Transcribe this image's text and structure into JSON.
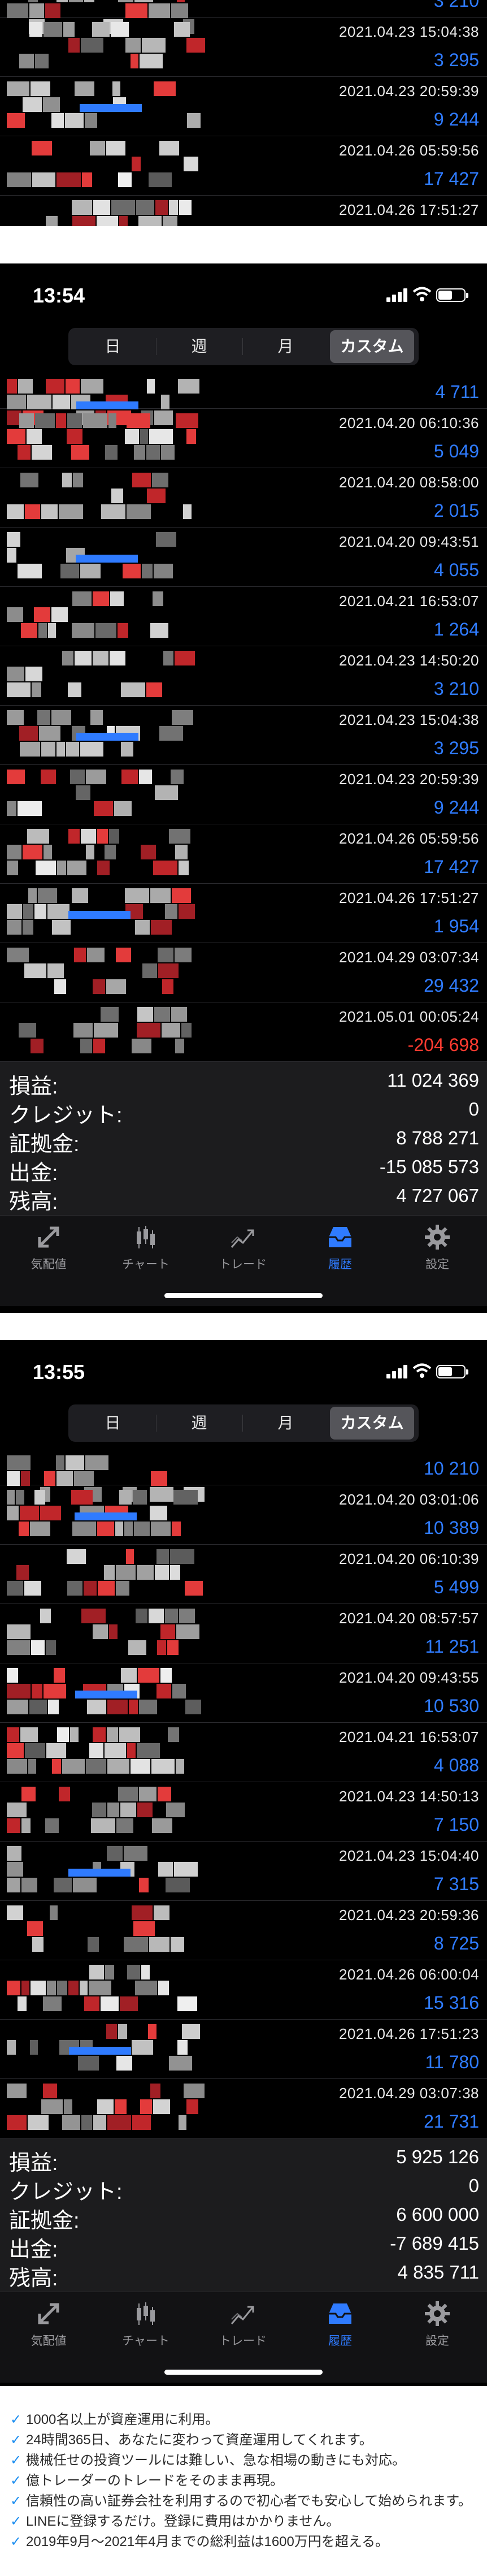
{
  "colors": {
    "positive": "#2f7bff",
    "negative": "#ff3b30",
    "active_tab": "#2f7bff",
    "check": "#1c8ef0"
  },
  "top_fragment": {
    "rows": [
      {
        "date": "",
        "amount": "3 210",
        "sign": "pos"
      },
      {
        "date": "2021.04.23 15:04:38",
        "amount": "3 295",
        "sign": "pos"
      },
      {
        "date": "2021.04.23 20:59:39",
        "amount": "9 244",
        "sign": "pos"
      },
      {
        "date": "2021.04.26 05:59:56",
        "amount": "17 427",
        "sign": "pos"
      },
      {
        "date": "2021.04.26 17:51:27",
        "amount": "",
        "sign": "pos"
      }
    ]
  },
  "screen1": {
    "time": "13:54",
    "battery_level": 0.55,
    "segments": [
      "日",
      "週",
      "月",
      "カスタム"
    ],
    "active_segment": 3,
    "rows": [
      {
        "date": "",
        "amount": "4 711",
        "sign": "pos"
      },
      {
        "date": "2021.04.20 06:10:36",
        "amount": "5 049",
        "sign": "pos"
      },
      {
        "date": "2021.04.20 08:58:00",
        "amount": "2 015",
        "sign": "pos"
      },
      {
        "date": "2021.04.20 09:43:51",
        "amount": "4 055",
        "sign": "pos"
      },
      {
        "date": "2021.04.21 16:53:07",
        "amount": "1 264",
        "sign": "pos"
      },
      {
        "date": "2021.04.23 14:50:20",
        "amount": "3 210",
        "sign": "pos"
      },
      {
        "date": "2021.04.23 15:04:38",
        "amount": "3 295",
        "sign": "pos"
      },
      {
        "date": "2021.04.23 20:59:39",
        "amount": "9 244",
        "sign": "pos"
      },
      {
        "date": "2021.04.26 05:59:56",
        "amount": "17 427",
        "sign": "pos"
      },
      {
        "date": "2021.04.26 17:51:27",
        "amount": "1 954",
        "sign": "pos"
      },
      {
        "date": "2021.04.29 03:07:34",
        "amount": "29 432",
        "sign": "pos"
      },
      {
        "date": "2021.05.01 00:05:24",
        "amount": "-204 698",
        "sign": "neg"
      }
    ],
    "summary": [
      {
        "label": "損益:",
        "value": "11 024 369"
      },
      {
        "label": "クレジット:",
        "value": "0"
      },
      {
        "label": "証拠金:",
        "value": "8 788 271"
      },
      {
        "label": "出金:",
        "value": "-15 085 573"
      },
      {
        "label": "残高:",
        "value": "4 727 067"
      }
    ],
    "tabs": [
      {
        "label": "気配値",
        "icon": "quotes-icon"
      },
      {
        "label": "チャート",
        "icon": "chart-icon"
      },
      {
        "label": "トレード",
        "icon": "trade-icon"
      },
      {
        "label": "履歴",
        "icon": "history-icon"
      },
      {
        "label": "設定",
        "icon": "settings-icon"
      }
    ],
    "active_tab": 3
  },
  "screen2": {
    "time": "13:55",
    "battery_level": 0.55,
    "segments": [
      "日",
      "週",
      "月",
      "カスタム"
    ],
    "active_segment": 3,
    "rows": [
      {
        "date": "",
        "amount": "10 210",
        "sign": "pos"
      },
      {
        "date": "2021.04.20 03:01:06",
        "amount": "10 389",
        "sign": "pos"
      },
      {
        "date": "2021.04.20 06:10:39",
        "amount": "5 499",
        "sign": "pos"
      },
      {
        "date": "2021.04.20 08:57:57",
        "amount": "11 251",
        "sign": "pos"
      },
      {
        "date": "2021.04.20 09:43:55",
        "amount": "10 530",
        "sign": "pos"
      },
      {
        "date": "2021.04.21 16:53:07",
        "amount": "4 088",
        "sign": "pos"
      },
      {
        "date": "2021.04.23 14:50:13",
        "amount": "7 150",
        "sign": "pos"
      },
      {
        "date": "2021.04.23 15:04:40",
        "amount": "7 315",
        "sign": "pos"
      },
      {
        "date": "2021.04.23 20:59:36",
        "amount": "8 725",
        "sign": "pos"
      },
      {
        "date": "2021.04.26 06:00:04",
        "amount": "15 316",
        "sign": "pos"
      },
      {
        "date": "2021.04.26 17:51:23",
        "amount": "11 780",
        "sign": "pos"
      },
      {
        "date": "2021.04.29 03:07:38",
        "amount": "21 731",
        "sign": "pos"
      }
    ],
    "summary": [
      {
        "label": "損益:",
        "value": "5 925 126"
      },
      {
        "label": "クレジット:",
        "value": "0"
      },
      {
        "label": "証拠金:",
        "value": "6 600 000"
      },
      {
        "label": "出金:",
        "value": "-7 689 415"
      },
      {
        "label": "残高:",
        "value": "4 835 711"
      }
    ],
    "tabs": [
      {
        "label": "気配値",
        "icon": "quotes-icon"
      },
      {
        "label": "チャート",
        "icon": "chart-icon"
      },
      {
        "label": "トレード",
        "icon": "trade-icon"
      },
      {
        "label": "履歴",
        "icon": "history-icon"
      },
      {
        "label": "設定",
        "icon": "settings-icon"
      }
    ],
    "active_tab": 3
  },
  "features": [
    "1000名以上が資産運用に利用。",
    "24時間365日、あなたに変わって資産運用してくれます。",
    "機械任せの投資ツールには難しい、急な相場の動きにも対応。",
    "億トレーダーのトレードをそのまま再現。",
    "信頼性の高い証券会社を利用するので初心者でも安心して始められます。",
    "LINEに登録するだけ。登録に費用はかかりません。",
    "2019年9月～2021年4月までの総利益は1600万円を超える。"
  ]
}
